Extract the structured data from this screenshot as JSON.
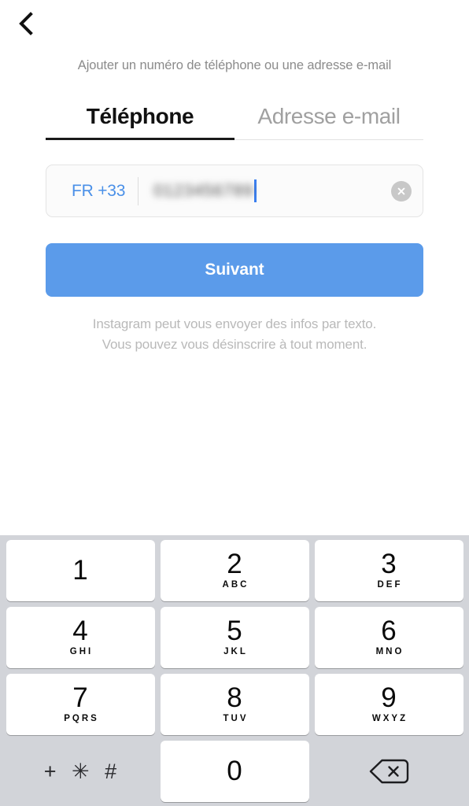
{
  "colors": {
    "accent_blue": "#5b9bea",
    "link_blue": "#4a90e8",
    "caret_blue": "#3b7ff0",
    "keypad_background": "#d2d4d9",
    "key_white": "#ffffff",
    "muted_text": "#8b8b8b",
    "note_text": "#b9b9b9",
    "inactive_tab": "#a0a0a0",
    "active_tab": "#111111"
  },
  "navbar": {
    "back_icon": "chevron-left-icon"
  },
  "header": {
    "subtitle": "Ajouter un numéro de téléphone ou une adresse e-mail"
  },
  "tabs": [
    {
      "label": "Téléphone",
      "active": true
    },
    {
      "label": "Adresse e-mail",
      "active": false
    }
  ],
  "phone_input": {
    "country_code": "FR +33",
    "value": "0123456789",
    "value_masked": true,
    "clear_icon": "clear-circle-icon",
    "caret_visible": true
  },
  "submit": {
    "label": "Suivant"
  },
  "legal_note": {
    "text": "Instagram peut vous envoyer des infos par texto. Vous pouvez vous désinscrire à tout moment."
  },
  "keypad": {
    "rows": [
      [
        {
          "digit": "1",
          "letters": "",
          "type": "key"
        },
        {
          "digit": "2",
          "letters": "ABC",
          "type": "key"
        },
        {
          "digit": "3",
          "letters": "DEF",
          "type": "key"
        }
      ],
      [
        {
          "digit": "4",
          "letters": "GHI",
          "type": "key"
        },
        {
          "digit": "5",
          "letters": "JKL",
          "type": "key"
        },
        {
          "digit": "6",
          "letters": "MNO",
          "type": "key"
        }
      ],
      [
        {
          "digit": "7",
          "letters": "PQRS",
          "type": "key"
        },
        {
          "digit": "8",
          "letters": "TUV",
          "type": "key"
        },
        {
          "digit": "9",
          "letters": "WXYZ",
          "type": "key"
        }
      ],
      [
        {
          "digit": "+ ✳ #",
          "letters": "",
          "type": "symbols"
        },
        {
          "digit": "0",
          "letters": "",
          "type": "key"
        },
        {
          "digit": "",
          "letters": "",
          "type": "backspace",
          "icon": "backspace-icon"
        }
      ]
    ]
  }
}
